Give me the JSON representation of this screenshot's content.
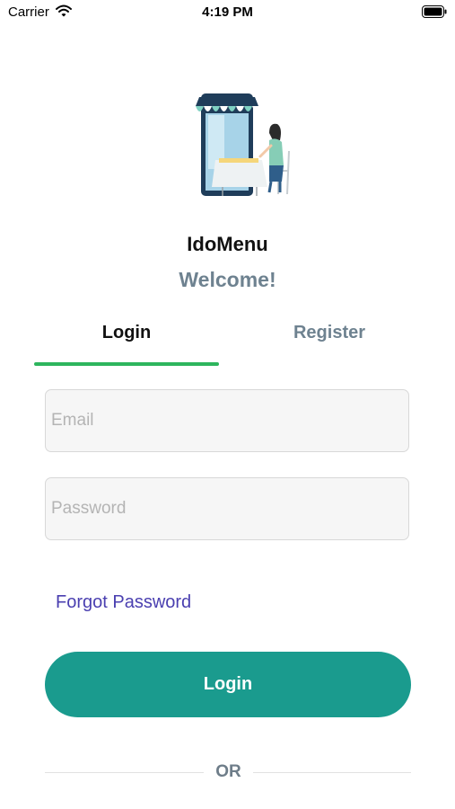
{
  "status_bar": {
    "carrier": "Carrier",
    "time": "4:19 PM"
  },
  "app": {
    "name": "IdoMenu",
    "welcome": "Welcome!"
  },
  "tabs": [
    {
      "label": "Login",
      "active": true
    },
    {
      "label": "Register",
      "active": false
    }
  ],
  "form": {
    "email": {
      "placeholder": "Email",
      "value": ""
    },
    "password": {
      "placeholder": "Password",
      "value": ""
    }
  },
  "forgot_password": "Forgot Password",
  "login_button": "Login",
  "divider_text": "OR",
  "colors": {
    "accent_green": "#2db55d",
    "button_teal": "#1a9b8e",
    "link_purple": "#4a3fb0",
    "muted_text": "#6e8290"
  },
  "icons": [
    "wifi-icon",
    "battery-icon",
    "store-illustration"
  ]
}
